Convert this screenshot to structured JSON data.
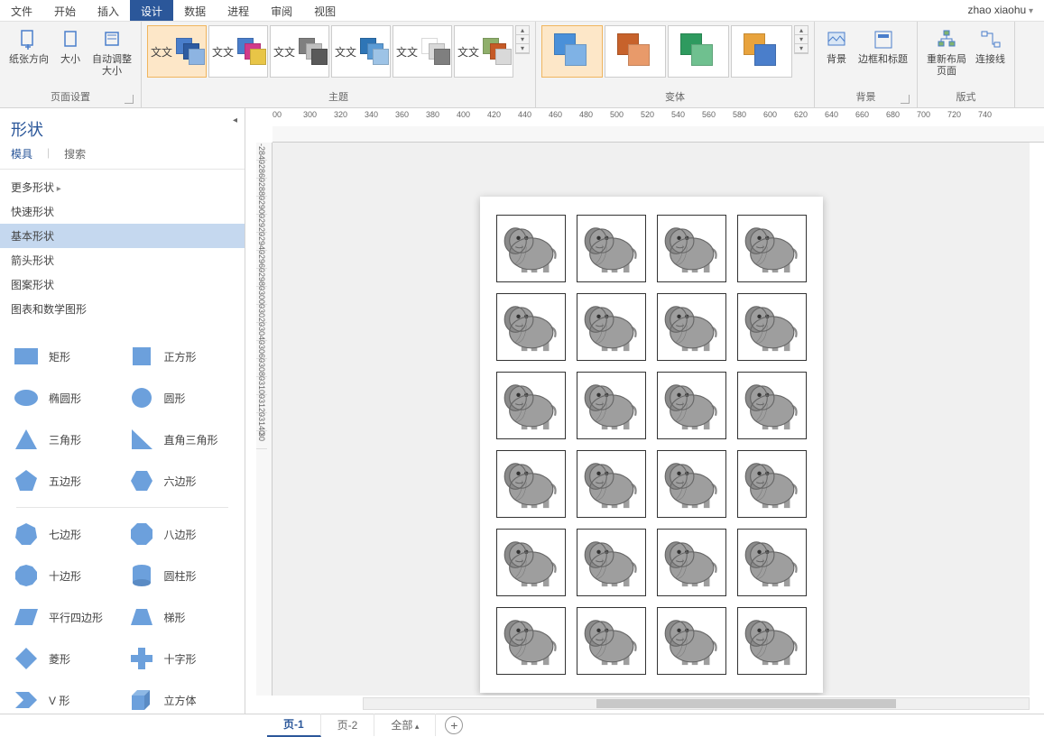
{
  "menu": {
    "tabs": [
      "文件",
      "开始",
      "插入",
      "设计",
      "数据",
      "进程",
      "审阅",
      "视图"
    ],
    "active": 3,
    "user": "zhao xiaohu"
  },
  "ribbon": {
    "groups": {
      "pageSetup": {
        "label": "页面设置",
        "items": [
          "纸张方向",
          "大小",
          "自动调整\n大小"
        ]
      },
      "theme": {
        "label": "主题",
        "swatchText": "文文",
        "themes": [
          {
            "colors": [
              "#4a7ecb",
              "#2e5ba0",
              "#8db4e2"
            ]
          },
          {
            "colors": [
              "#4a7ecb",
              "#d13a8a",
              "#e8c547"
            ]
          },
          {
            "colors": [
              "#7f7f7f",
              "#bfbfbf",
              "#595959"
            ]
          },
          {
            "colors": [
              "#2e75b6",
              "#5b9bd5",
              "#9dc3e6"
            ]
          },
          {
            "colors": [
              "#ffffff",
              "#d9d9d9",
              "#7f7f7f"
            ]
          },
          {
            "colors": [
              "#8faf6b",
              "#c55a27",
              "#d9d9d9"
            ]
          }
        ]
      },
      "variant": {
        "label": "变体",
        "variants": [
          {
            "colors": [
              "#4a90d9",
              "#7fb2e5"
            ]
          },
          {
            "colors": [
              "#c7622b",
              "#e89a6a"
            ]
          },
          {
            "colors": [
              "#2e9a5f",
              "#6fc08f"
            ]
          },
          {
            "colors": [
              "#e8a33d",
              "#4a7ecb"
            ]
          }
        ]
      },
      "background": {
        "label": "背景",
        "items": [
          "背景",
          "边框和标题"
        ]
      },
      "layout": {
        "label": "版式",
        "items": [
          "重新布局\n页面",
          "连接线"
        ]
      }
    }
  },
  "sidepanel": {
    "title": "形状",
    "tabs": {
      "stencil": "模具",
      "search": "搜索",
      "active": 0
    },
    "categories": [
      {
        "label": "更多形状",
        "hasmore": true
      },
      {
        "label": "快速形状"
      },
      {
        "label": "基本形状",
        "selected": true
      },
      {
        "label": "箭头形状"
      },
      {
        "label": "图案形状"
      },
      {
        "label": "图表和数学图形"
      }
    ],
    "shapes": [
      {
        "l": {
          "name": "矩形",
          "svg": "rect"
        },
        "r": {
          "name": "正方形",
          "svg": "square"
        }
      },
      {
        "l": {
          "name": "椭圆形",
          "svg": "ellipse"
        },
        "r": {
          "name": "圆形",
          "svg": "circle"
        }
      },
      {
        "l": {
          "name": "三角形",
          "svg": "triangle"
        },
        "r": {
          "name": "直角三角形",
          "svg": "rtriangle"
        }
      },
      {
        "l": {
          "name": "五边形",
          "svg": "pentagon"
        },
        "r": {
          "name": "六边形",
          "svg": "hexagon"
        }
      },
      {
        "divider": true
      },
      {
        "l": {
          "name": "七边形",
          "svg": "heptagon"
        },
        "r": {
          "name": "八边形",
          "svg": "octagon"
        }
      },
      {
        "l": {
          "name": "十边形",
          "svg": "decagon"
        },
        "r": {
          "name": "圆柱形",
          "svg": "cylinder"
        }
      },
      {
        "l": {
          "name": "平行四边形",
          "svg": "para"
        },
        "r": {
          "name": "梯形",
          "svg": "trap"
        }
      },
      {
        "l": {
          "name": "菱形",
          "svg": "diamond"
        },
        "r": {
          "name": "十字形",
          "svg": "cross"
        }
      },
      {
        "l": {
          "name": "V 形",
          "svg": "chevron"
        },
        "r": {
          "name": "立方体",
          "svg": "cube"
        }
      }
    ]
  },
  "ruler": {
    "h": [
      "00",
      "300",
      "320",
      "340",
      "360",
      "380",
      "400",
      "420",
      "440",
      "460",
      "480",
      "500",
      "520",
      "540",
      "560",
      "580",
      "600",
      "620",
      "640",
      "660",
      "680",
      "700",
      "720",
      "740"
    ],
    "v": [
      "-2840",
      "-2860",
      "-2880",
      "-2900",
      "-2920",
      "-2940",
      "-2960",
      "-2980",
      "-3000",
      "-3020",
      "-3040",
      "-3060",
      "-3080",
      "-3100",
      "-3120",
      "-3140",
      "30"
    ]
  },
  "canvas": {
    "grid": {
      "rows": 6,
      "cols": 4,
      "content": "elephant"
    }
  },
  "pageTabs": {
    "tabs": [
      {
        "label": "页-1",
        "active": true
      },
      {
        "label": "页-2"
      }
    ],
    "all": "全部"
  }
}
